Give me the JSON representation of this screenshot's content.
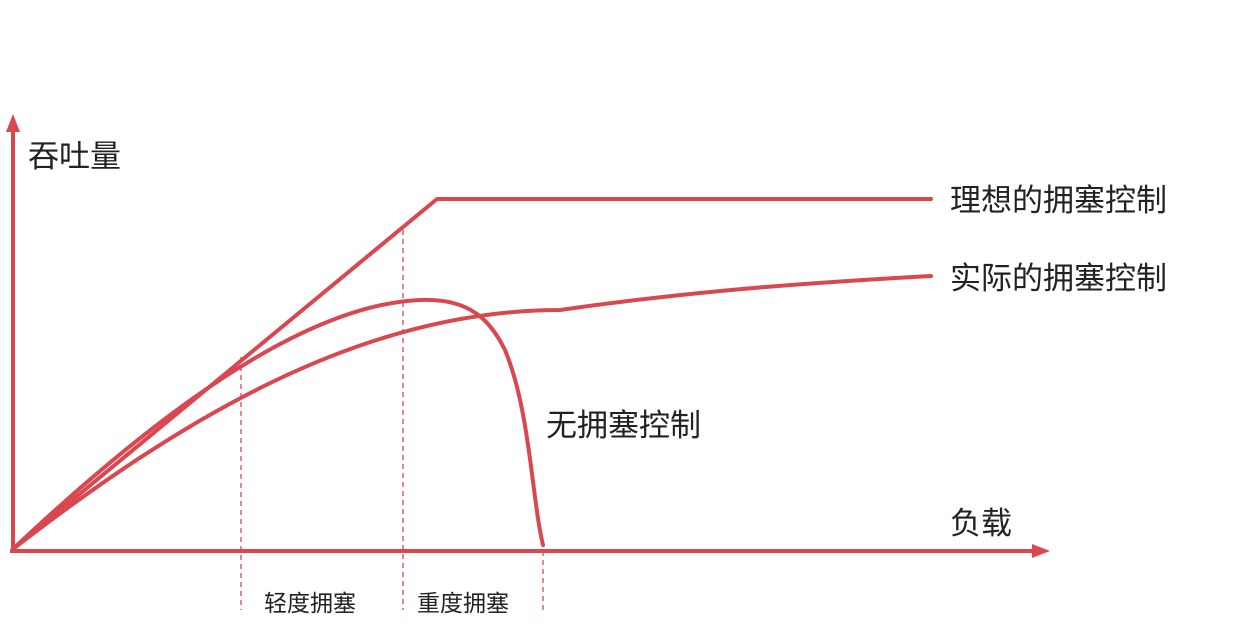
{
  "axes": {
    "y_label": "吞吐量",
    "x_label": "负载"
  },
  "curves": {
    "ideal": "理想的拥塞控制",
    "actual": "实际的拥塞控制",
    "none": "无拥塞控制"
  },
  "regions": {
    "light": "轻度拥塞",
    "heavy": "重度拥塞"
  },
  "colors": {
    "stroke": "#D9474F",
    "text": "#222222"
  }
}
